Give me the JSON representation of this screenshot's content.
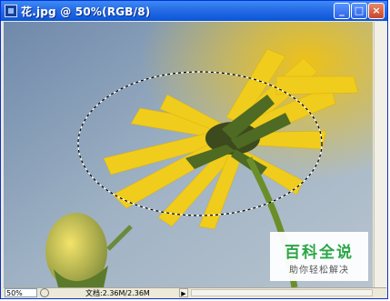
{
  "window": {
    "title": "花.jpg @ 50%(RGB/8)",
    "controls": [
      "minimize",
      "maximize",
      "close"
    ]
  },
  "statusbar": {
    "zoom": "50%",
    "doc_info": "文档:2.36M/2.36M",
    "arrow": "▶"
  },
  "watermark": {
    "title": "百科全说",
    "subtitle": "助你轻松解决"
  },
  "colors": {
    "titlebar": "#2a6ee8",
    "petal": "#f2cf1d",
    "background": "#8aa3bf"
  },
  "icons": {
    "app": "photoshop-doc-icon",
    "minimize": "minimize-icon",
    "maximize": "maximize-icon",
    "close": "close-icon",
    "navigator": "navigator-icon"
  }
}
